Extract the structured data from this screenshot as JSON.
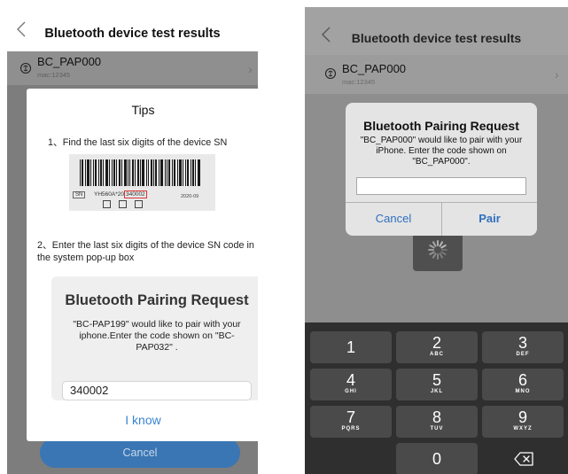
{
  "left": {
    "nav": {
      "title": "Bluetooth device test results"
    },
    "device": {
      "name": "BC_PAP000",
      "mac": "mac:12345"
    },
    "cancel_label": "Cancel",
    "tips": {
      "title": "Tips",
      "step1": "1、Find the last six digits of the device SN",
      "label": {
        "sn_box": "SN",
        "sn_prefix": "YH560A*20",
        "sn_highlight": "340002",
        "date": "2020-09"
      },
      "step2": "2、Enter the last six digits of the device SN code in the system pop-up box",
      "demo": {
        "title": "Bluetooth Pairing Request",
        "message": "\"BC-PAP199\" would like to pair with your iphone.Enter the code shown on \"BC-PAP032\" .",
        "code": "340002"
      },
      "confirm_label": "I know"
    }
  },
  "right": {
    "nav": {
      "title": "Bluetooth device test results"
    },
    "device": {
      "name": "BC_PAP000",
      "mac": "mac:12345"
    },
    "alert": {
      "title": "Bluetooth Pairing Request",
      "message": "\"BC_PAP000\" would like to pair with your iPhone. Enter the code shown on \"BC_PAP000\".",
      "input_value": "",
      "cancel_label": "Cancel",
      "pair_label": "Pair"
    },
    "keypad": [
      {
        "num": "1",
        "letters": ""
      },
      {
        "num": "2",
        "letters": "ABC"
      },
      {
        "num": "3",
        "letters": "DEF"
      },
      {
        "num": "4",
        "letters": "GHI"
      },
      {
        "num": "5",
        "letters": "JKL"
      },
      {
        "num": "6",
        "letters": "MNO"
      },
      {
        "num": "7",
        "letters": "PQRS"
      },
      {
        "num": "8",
        "letters": "TUV"
      },
      {
        "num": "9",
        "letters": "WXYZ"
      },
      {
        "num": "0",
        "letters": ""
      }
    ]
  },
  "colors": {
    "accent_blue": "#3a84d2",
    "cancel_button_blue": "#3a76b4",
    "keyboard_bg": "#2f2f2f",
    "key_bg": "#4a4a4a",
    "serial_highlight": "#dd3333"
  },
  "icons": [
    "chevron-left-icon",
    "bluetooth-device-icon",
    "chevron-right-icon",
    "barcode-icon",
    "spinner-icon",
    "delete-key-icon"
  ]
}
